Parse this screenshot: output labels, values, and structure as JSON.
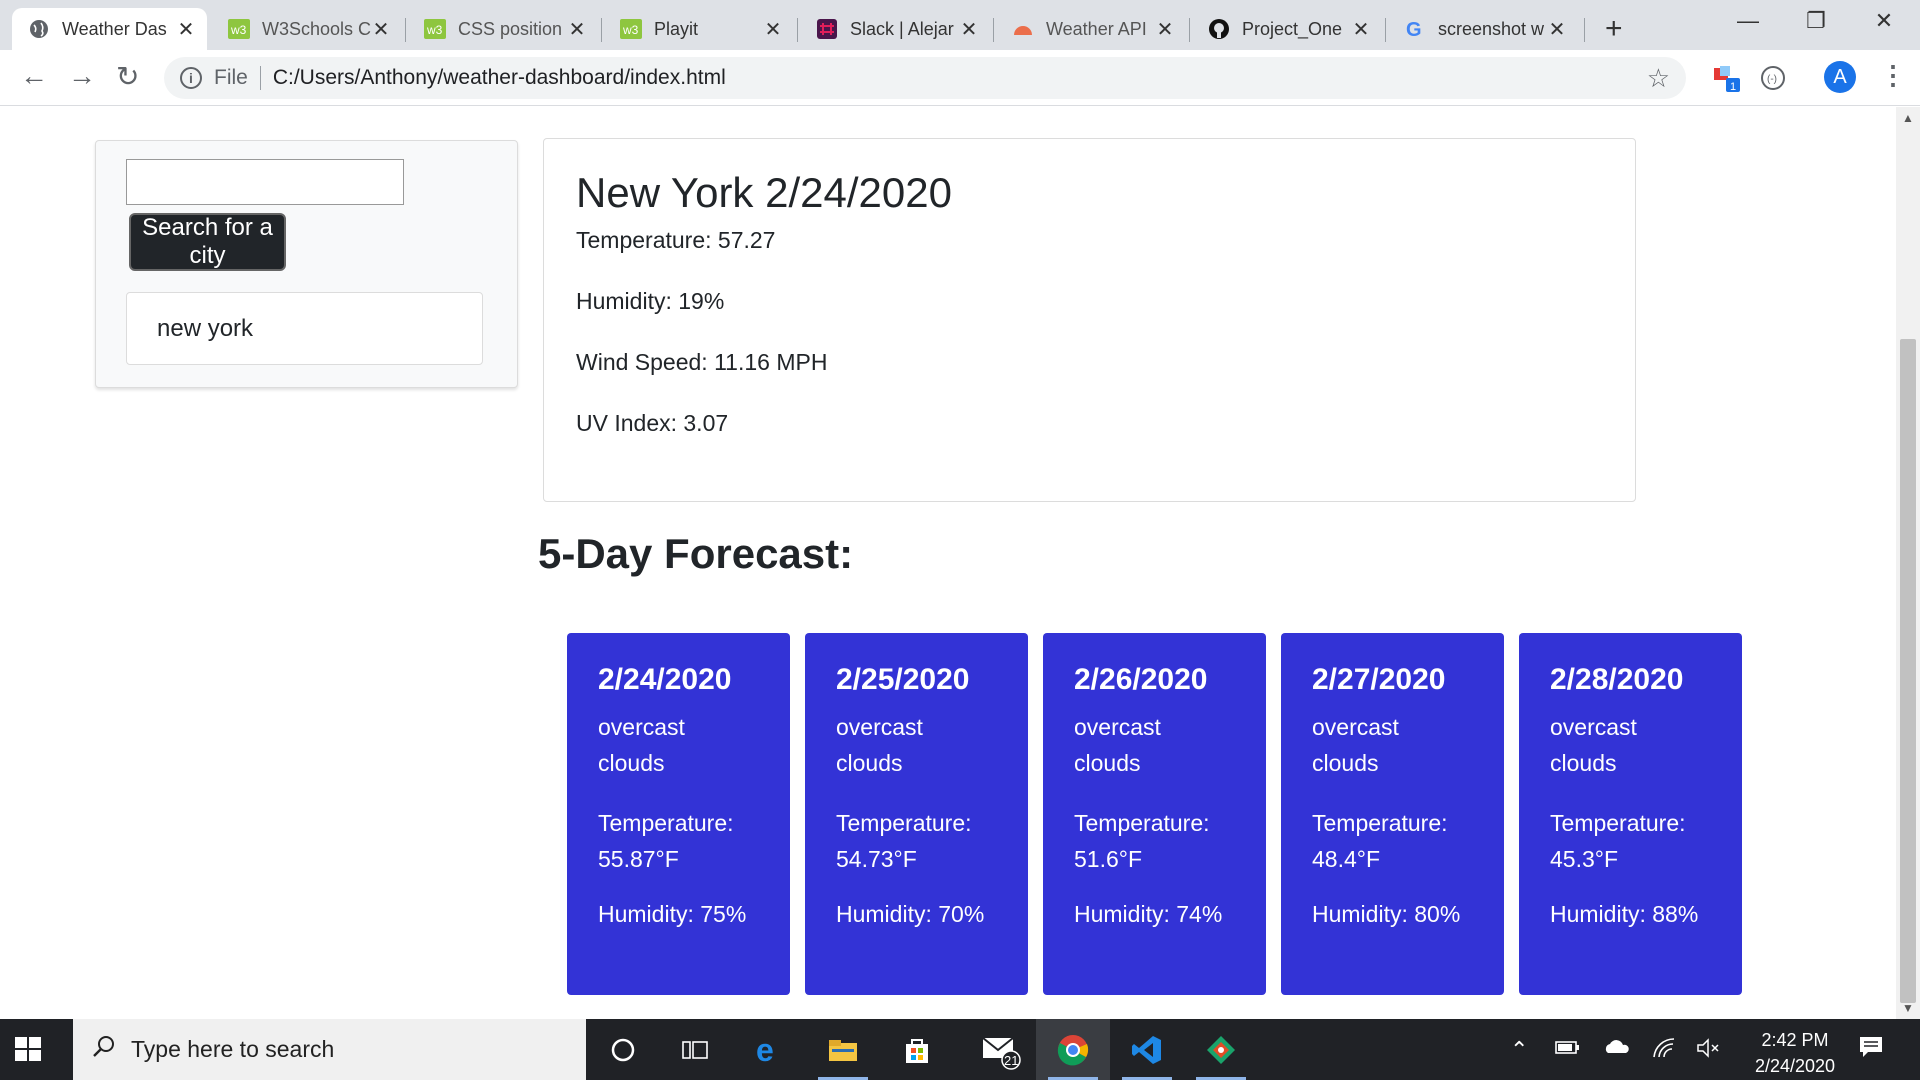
{
  "browser": {
    "tabs": [
      {
        "title": "Weather Das",
        "icon": "globe-icon",
        "active": true
      },
      {
        "title": "W3Schools C",
        "icon": "w3schools-icon"
      },
      {
        "title": "CSS position",
        "icon": "w3schools-icon"
      },
      {
        "title": "Playit",
        "icon": "w3schools-icon"
      },
      {
        "title": "Slack | Alejar",
        "icon": "slack-icon"
      },
      {
        "title": "Weather API",
        "icon": "openweather-icon"
      },
      {
        "title": "Project_One",
        "icon": "github-icon"
      },
      {
        "title": "screenshot w",
        "icon": "google-icon"
      }
    ],
    "address": {
      "scheme_label": "File",
      "url": "C:/Users/Anthony/weather-dashboard/index.html"
    },
    "profile_initial": "A",
    "extension_badge": "1"
  },
  "search_panel": {
    "input_value": "",
    "button_label": "Search for a city",
    "history": [
      "new york"
    ]
  },
  "current_weather": {
    "title": "New York 2/24/2020",
    "temperature": "Temperature: 57.27",
    "humidity": "Humidity: 19%",
    "wind_speed": "Wind Speed: 11.16 MPH",
    "uv_index": "UV Index: 3.07"
  },
  "forecast": {
    "heading": "5-Day Forecast:",
    "days": [
      {
        "date": "2/24/2020",
        "description": "overcast clouds",
        "temp_label": "Temperature:",
        "temp": "55.87°F",
        "humidity": "Humidity: 75%"
      },
      {
        "date": "2/25/2020",
        "description": "overcast clouds",
        "temp_label": "Temperature:",
        "temp": "54.73°F",
        "humidity": "Humidity: 70%"
      },
      {
        "date": "2/26/2020",
        "description": "overcast clouds",
        "temp_label": "Temperature:",
        "temp": "51.6°F",
        "humidity": "Humidity: 74%"
      },
      {
        "date": "2/27/2020",
        "description": "overcast clouds",
        "temp_label": "Temperature:",
        "temp": "48.4°F",
        "humidity": "Humidity: 80%"
      },
      {
        "date": "2/28/2020",
        "description": "overcast clouds",
        "temp_label": "Temperature:",
        "temp": "45.3°F",
        "humidity": "Humidity: 88%"
      }
    ],
    "card_color": "#3333d6"
  },
  "taskbar": {
    "search_placeholder": "Type here to search",
    "mail_badge": "21",
    "time": "2:42 PM",
    "date": "2/24/2020"
  }
}
